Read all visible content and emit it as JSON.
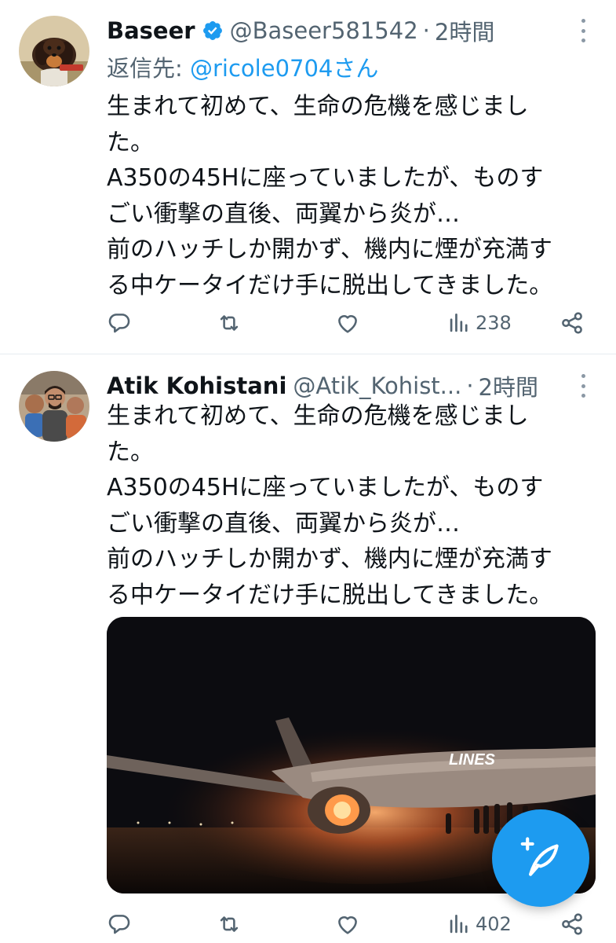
{
  "tweets": [
    {
      "name": "Baseer",
      "verified": true,
      "handle": "@Baseer581542",
      "separator": "·",
      "time": "2時間",
      "reply_prefix": "返信先: ",
      "reply_to": "@ricole0704さん",
      "lines": [
        "生まれて初めて、生命の危機を感じまし",
        "た。",
        "A350の45Hに座っていましたが、ものす",
        "ごい衝撃の直後、両翼から炎が…",
        "前のハッチしか開かず、機内に煙が充満す",
        "る中ケータイだけ手に脱出してきました。"
      ],
      "stats": {
        "views": "238"
      }
    },
    {
      "name": "Atik Kohistani",
      "handle": "@Atik_Kohist...",
      "separator": "·",
      "time": "2時間",
      "lines": [
        "生まれて初めて、生命の危機を感じまし",
        "た。",
        "A350の45Hに座っていましたが、ものす",
        "ごい衝撃の直後、両翼から炎が…",
        "前のハッチしか開かず、機内に煙が充満す",
        "る中ケータイだけ手に脱出してきました。"
      ],
      "media": {
        "lettering": "LINES"
      },
      "stats": {
        "views": "402"
      }
    }
  ],
  "icons": {
    "verified": "verified-badge-icon",
    "more": "more-vertical-icon",
    "reply": "reply-icon",
    "retweet": "retweet-icon",
    "like": "like-icon",
    "views": "views-icon",
    "share": "share-icon",
    "compose": "compose-feather-icon"
  },
  "colors": {
    "accent": "#1d9bf0",
    "text": "#0f1419",
    "secondary": "#536471"
  }
}
